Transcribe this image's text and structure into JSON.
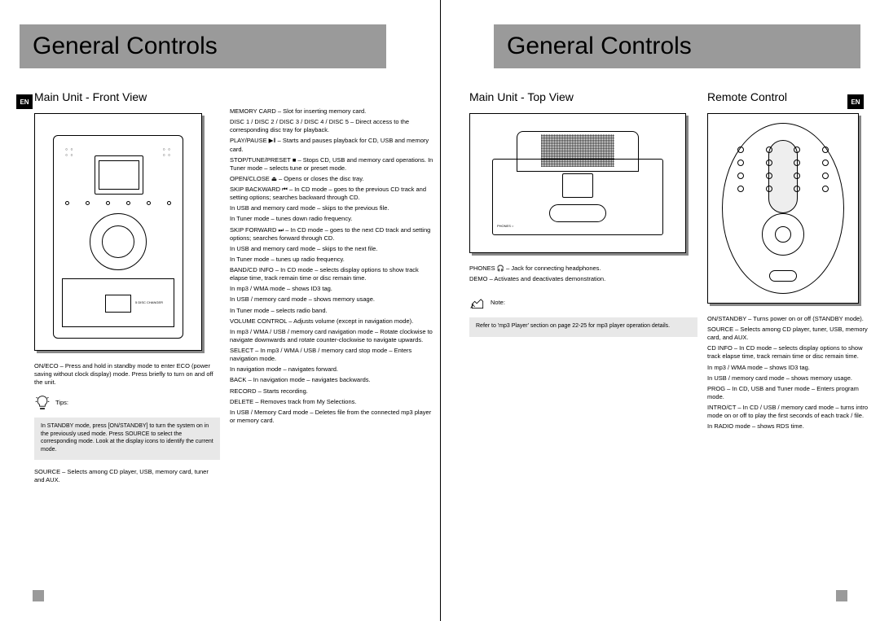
{
  "header": {
    "title": "General Controls"
  },
  "lang": "EN",
  "left": {
    "section1_title": "Main Unit - Front View",
    "disc_label": "5 DISC CHANGER",
    "on_eco": "ON/ECO – Press and hold in standby mode to enter ECO (power saving without clock display) mode. Press briefly to turn on and off the unit.",
    "tips_label": "Tips:",
    "tips_body": "In STANDBY mode, press [ON/STANDBY] to turn the system on in the previously used mode. Press SOURCE to select the corresponding mode. Look at the display icons to identify the current mode.",
    "source": "SOURCE – Selects among CD player, USB, memory card, tuner and AUX.",
    "col2": [
      "MEMORY CARD – Slot for inserting memory card.",
      "DISC 1 / DISC 2 / DISC 3 / DISC 4 / DISC 5 – Direct access to the corresponding disc tray for playback.",
      "PLAY/PAUSE ▶‖ – Starts and pauses playback for CD, USB and memory card.",
      "STOP/TUNE/PRESET ■ – Stops CD, USB and memory card operations. In Tuner mode – selects tune or preset mode.",
      "OPEN/CLOSE ⏏ – Opens or closes the disc tray.",
      "SKIP BACKWARD ⏮ – In CD mode – goes to the previous CD track and setting options; searches backward through CD.",
      "In USB and memory card mode – skips to the previous file.",
      "In Tuner mode – tunes down radio frequency.",
      "SKIP FORWARD ⏭ – In CD mode – goes to the next CD track and setting options; searches forward through CD.",
      "In USB and memory card mode – skips to the next file.",
      "In Tuner mode – tunes up radio frequency.",
      "BAND/CD INFO – In CD mode – selects display options to show track elapse time, track remain time or disc remain time.",
      "In mp3 / WMA mode – shows ID3 tag.",
      "In USB / memory card mode – shows memory usage.",
      "In Tuner mode – selects radio band.",
      "VOLUME CONTROL – Adjusts volume (except in navigation mode).",
      "In mp3 / WMA / USB / memory card navigation mode – Rotate clockwise to navigate downwards and rotate counter-clockwise to navigate upwards.",
      "SELECT – In mp3 / WMA / USB / memory card stop mode – Enters navigation mode.",
      "In navigation mode – navigates forward.",
      "BACK – In navigation mode – navigates backwards.",
      "RECORD – Starts recording.",
      "DELETE – Removes track from My Selections.",
      "In USB / Memory Card mode – Deletes file from the connected mp3 player or memory card."
    ]
  },
  "right": {
    "section2_title": "Main Unit - Top View",
    "section3_title": "Remote Control",
    "phones": "PHONES 🎧 – Jack for connecting headphones.",
    "demo": "DEMO – Activates and deactivates demonstration.",
    "note_label": "Note:",
    "note_body": "Refer to 'mp3 Player' section on page 22-25 for mp3 player operation details.",
    "remote": [
      "ON/STANDBY – Turns power on or off (STANDBY mode).",
      "SOURCE – Selects among CD player, tuner, USB, memory card, and AUX.",
      "CD INFO – In CD mode – selects display options to show track elapse time, track remain time or disc remain time.",
      "In mp3 / WMA mode – shows ID3 tag.",
      "In USB / memory card mode – shows memory usage.",
      "PROG – In CD, USB and Tuner mode – Enters program mode.",
      "INTRO/CT – In CD / USB / memory card mode – turns intro mode on or off to play the first seconds of each track / file.",
      "In RADIO mode – shows RDS time."
    ]
  }
}
